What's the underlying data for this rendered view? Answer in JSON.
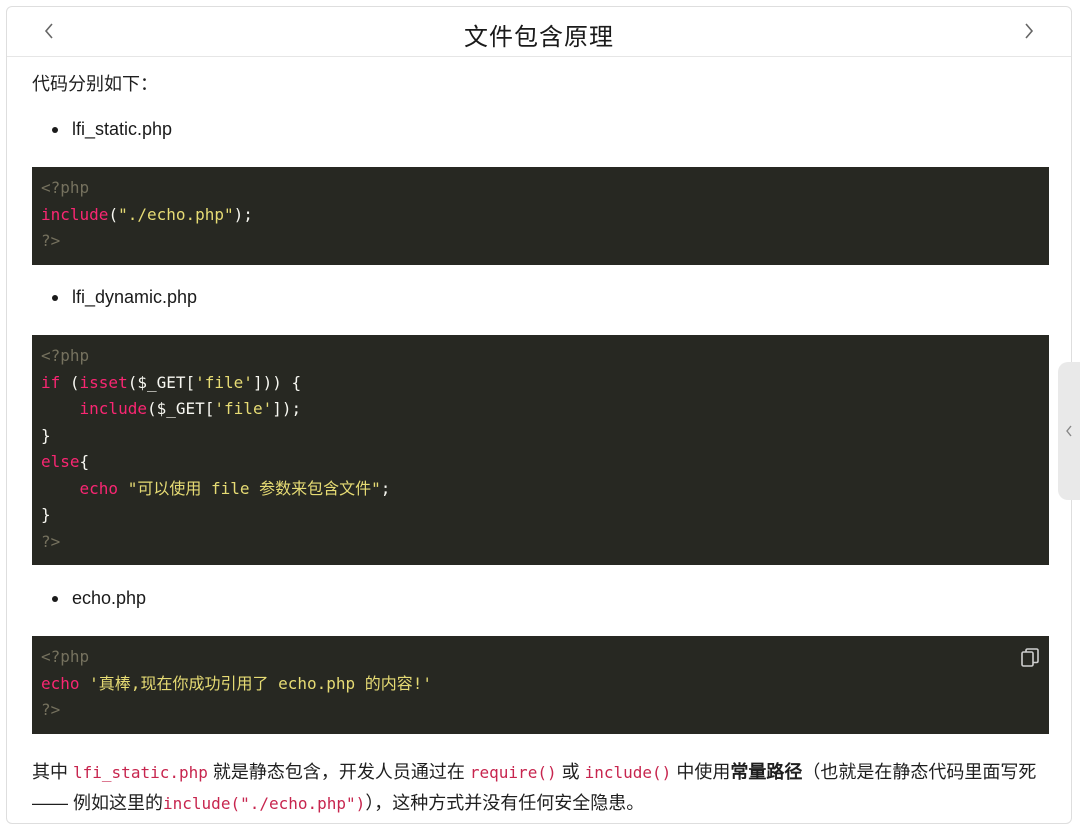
{
  "header": {
    "title": "文件包含原理",
    "prev_icon": "chevron-left-icon",
    "next_icon": "chevron-right-icon"
  },
  "intro": "代码分别如下：",
  "files": [
    {
      "name": "lfi_static.php"
    },
    {
      "name": "lfi_dynamic.php"
    },
    {
      "name": "echo.php"
    }
  ],
  "code_static": {
    "line1": "<?php",
    "line2_kw": "include",
    "line2_p1": "(",
    "line2_str": "\"./echo.php\"",
    "line2_p2": ");",
    "line3": "?>"
  },
  "code_dynamic": {
    "open": "<?php",
    "l2_kw1": "if",
    "l2_p1": " (",
    "l2_kw2": "isset",
    "l2_p2": "($_GET[",
    "l2_str": "'file'",
    "l2_p3": "])) {",
    "l3_kw": "include",
    "l3_p1": "($_GET[",
    "l3_str": "'file'",
    "l3_p2": "]);",
    "l4": "}",
    "l5_kw": "else",
    "l5_p": "{",
    "l6_kw": "echo",
    "l6_str": "\"可以使用 file 参数来包含文件\"",
    "l6_p": ";",
    "l7": "}",
    "close": "?>"
  },
  "code_echo": {
    "open": "<?php",
    "l2_kw": "echo",
    "l2_str": "'真棒,现在你成功引用了 echo.php 的内容!'",
    "close": "?>",
    "copy_icon": "copy-icon"
  },
  "outro": {
    "t1": "其中 ",
    "c1": "lfi_static.php",
    "t2": " 就是静态包含，开发人员通过在 ",
    "c2": "require()",
    "t3": " 或 ",
    "c3": "include()",
    "t4": " 中使用",
    "b1": "常量路径",
    "t5": "（也就是在静态代码里面写死—— 例如这里的",
    "c4": "include(\"./echo.php\")",
    "t6": "），这种方式并没有任何安全隐患。"
  },
  "side_handle_icon": "chevron-left-icon",
  "colors": {
    "code_bg": "#272822",
    "comment": "#75715e",
    "keyword": "#f92672",
    "string": "#e6db74",
    "inline_code": "#c7254e"
  }
}
